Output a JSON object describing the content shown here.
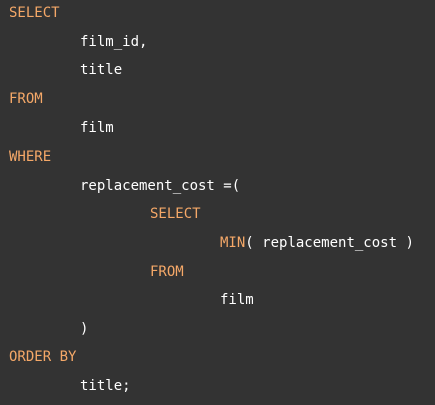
{
  "colors": {
    "background": "#333333",
    "keyword": "#f5a868",
    "text": "#ffffff"
  },
  "code": {
    "select": "SELECT",
    "col_film_id": "film_id,",
    "col_title": "title",
    "from": "FROM",
    "table_film": "film",
    "where": "WHERE",
    "where_cond": "replacement_cost =(",
    "sub_select": "SELECT",
    "sub_fn": "MIN",
    "sub_fn_args": "( replacement_cost )",
    "sub_from": "FROM",
    "sub_table": "film",
    "close_paren": ")",
    "order_by": "ORDER BY",
    "order_col": "title;"
  }
}
